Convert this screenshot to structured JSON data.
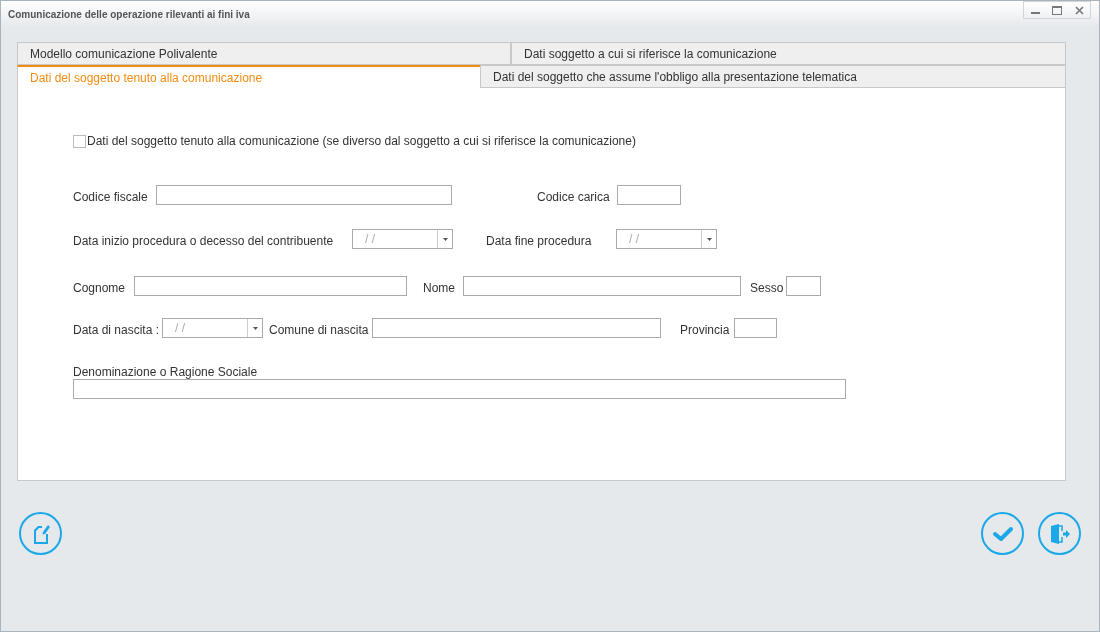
{
  "window": {
    "title": "Comunicazione delle operazione rilevanti ai fini iva"
  },
  "tab_rows": [
    {
      "tabs": [
        {
          "label": "Modello comunicazione Polivalente",
          "selected": false
        },
        {
          "label": "Dati soggetto a cui si riferisce la comunicazione",
          "selected": false
        }
      ]
    },
    {
      "tabs": [
        {
          "label": "Dati del soggetto tenuto alla comunicazione",
          "selected": true
        },
        {
          "label": "Dati del soggetto che assume l'obbligo alla presentazione telematica",
          "selected": false
        }
      ]
    }
  ],
  "checkbox": {
    "label": "Dati del soggetto tenuto alla comunicazione (se diverso dal soggetto a cui si riferisce la comunicazione)",
    "checked": false
  },
  "form_rows": [
    [
      {
        "kind": "label",
        "text": "Codice fiscale"
      },
      {
        "kind": "text"
      },
      {
        "kind": "label",
        "text": "Codice carica"
      },
      {
        "kind": "text"
      }
    ],
    [
      {
        "kind": "label",
        "text": "Data inizio procedura o decesso del contribuente"
      },
      {
        "kind": "date",
        "value": "/ /"
      },
      {
        "kind": "label",
        "text": "Data fine procedura"
      },
      {
        "kind": "date",
        "value": "/ /"
      }
    ],
    [
      {
        "kind": "label",
        "text": "Cognome"
      },
      {
        "kind": "text"
      },
      {
        "kind": "label",
        "text": "Nome"
      },
      {
        "kind": "text"
      },
      {
        "kind": "label",
        "text": "Sesso"
      },
      {
        "kind": "text"
      }
    ],
    [
      {
        "kind": "label",
        "text": "Data di nascita :"
      },
      {
        "kind": "date",
        "value": "/ /"
      },
      {
        "kind": "label",
        "text": "Comune di nascita"
      },
      {
        "kind": "text"
      },
      {
        "kind": "label",
        "text": "Provincia"
      },
      {
        "kind": "text"
      }
    ]
  ],
  "denominazione": {
    "label": "Denominazione o Ragione Sociale"
  }
}
